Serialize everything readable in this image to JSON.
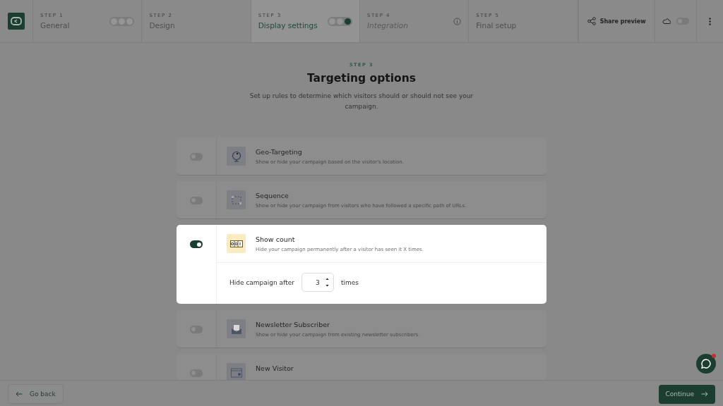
{
  "header": {
    "steps": [
      {
        "step": "STEP 1",
        "label": "General",
        "selected": false,
        "disabled": false,
        "dots": [
          {
            "filled": false
          },
          {
            "filled": false
          },
          {
            "filled": false
          }
        ]
      },
      {
        "step": "STEP 2",
        "label": "Design",
        "selected": false,
        "disabled": false
      },
      {
        "step": "STEP 3",
        "label": "Display settings",
        "selected": true,
        "disabled": false,
        "dots": [
          {
            "filled": false
          },
          {
            "filled": false
          },
          {
            "filled": true
          }
        ]
      },
      {
        "step": "STEP 4",
        "label": "Integration",
        "selected": false,
        "disabled": true,
        "info": true
      },
      {
        "step": "STEP 5",
        "label": "Final setup",
        "selected": false,
        "disabled": false
      }
    ],
    "share": "Share preview",
    "cloud_toggle": {
      "on": false
    }
  },
  "intro": {
    "step": "STEP 3",
    "title": "Targeting options",
    "subtitle": "Set up rules to determine which visitors should or should not see your campaign."
  },
  "options": [
    {
      "kind": "globe",
      "title": "Geo-Targeting",
      "description": "Show or hide your campaign based on the visitor's location.",
      "on": false,
      "focused": false
    },
    {
      "kind": "sequence",
      "title": "Sequence",
      "description": "Show or hide your campaign from visitors who have followed a specific path of URLs.",
      "on": false,
      "focused": false
    },
    {
      "kind": "counter",
      "title": "Show count",
      "description": "Hide your campaign permanently after a visitor has seen it X times.",
      "on": true,
      "focused": true,
      "setting": {
        "label": "Hide campaign after",
        "value": "3",
        "unit": "times"
      }
    },
    {
      "kind": "envelope",
      "title": "Newsletter Subscriber",
      "description": "Show or hide your campaign from existing newsletter subscribers.",
      "on": false,
      "focused": false
    },
    {
      "kind": "window",
      "title": "New Visitor",
      "on": false,
      "focused": false
    }
  ],
  "footer": {
    "back": "Go back",
    "continue": "Continue"
  }
}
